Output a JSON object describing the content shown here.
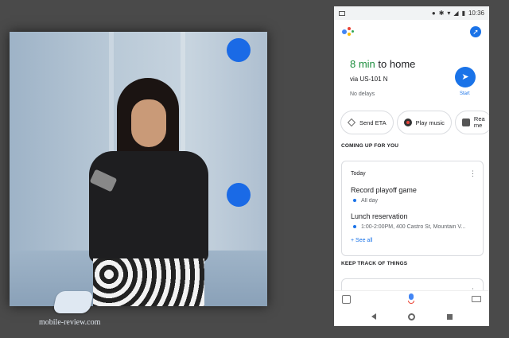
{
  "status_bar": {
    "time": "10:36"
  },
  "commute": {
    "duration": "8 min",
    "destination_text": " to home",
    "via": "via US-101 N",
    "traffic": "No delays",
    "start_label": "Start"
  },
  "chips": [
    {
      "label": "Send ETA",
      "icon": "diamond-icon"
    },
    {
      "label": "Play music",
      "icon": "music-icon"
    },
    {
      "label": "Rea\nme",
      "icon": "message-icon"
    }
  ],
  "sections": {
    "coming_up": "COMING UP FOR YOU",
    "keep_track": "KEEP TRACK OF THINGS"
  },
  "agenda": {
    "day": "Today",
    "events": [
      {
        "title": "Record playoff game",
        "detail": "All day"
      },
      {
        "title": "Lunch reservation",
        "detail": "1:00-2:00PM, 400 Castro St, Mountain V..."
      }
    ],
    "see_all": "+ See all"
  },
  "watermark": {
    "text": "mobile-review.com"
  },
  "colors": {
    "accent": "#1a73e8",
    "green": "#1e8e3e",
    "stage_dot": "#1a6ae6"
  }
}
